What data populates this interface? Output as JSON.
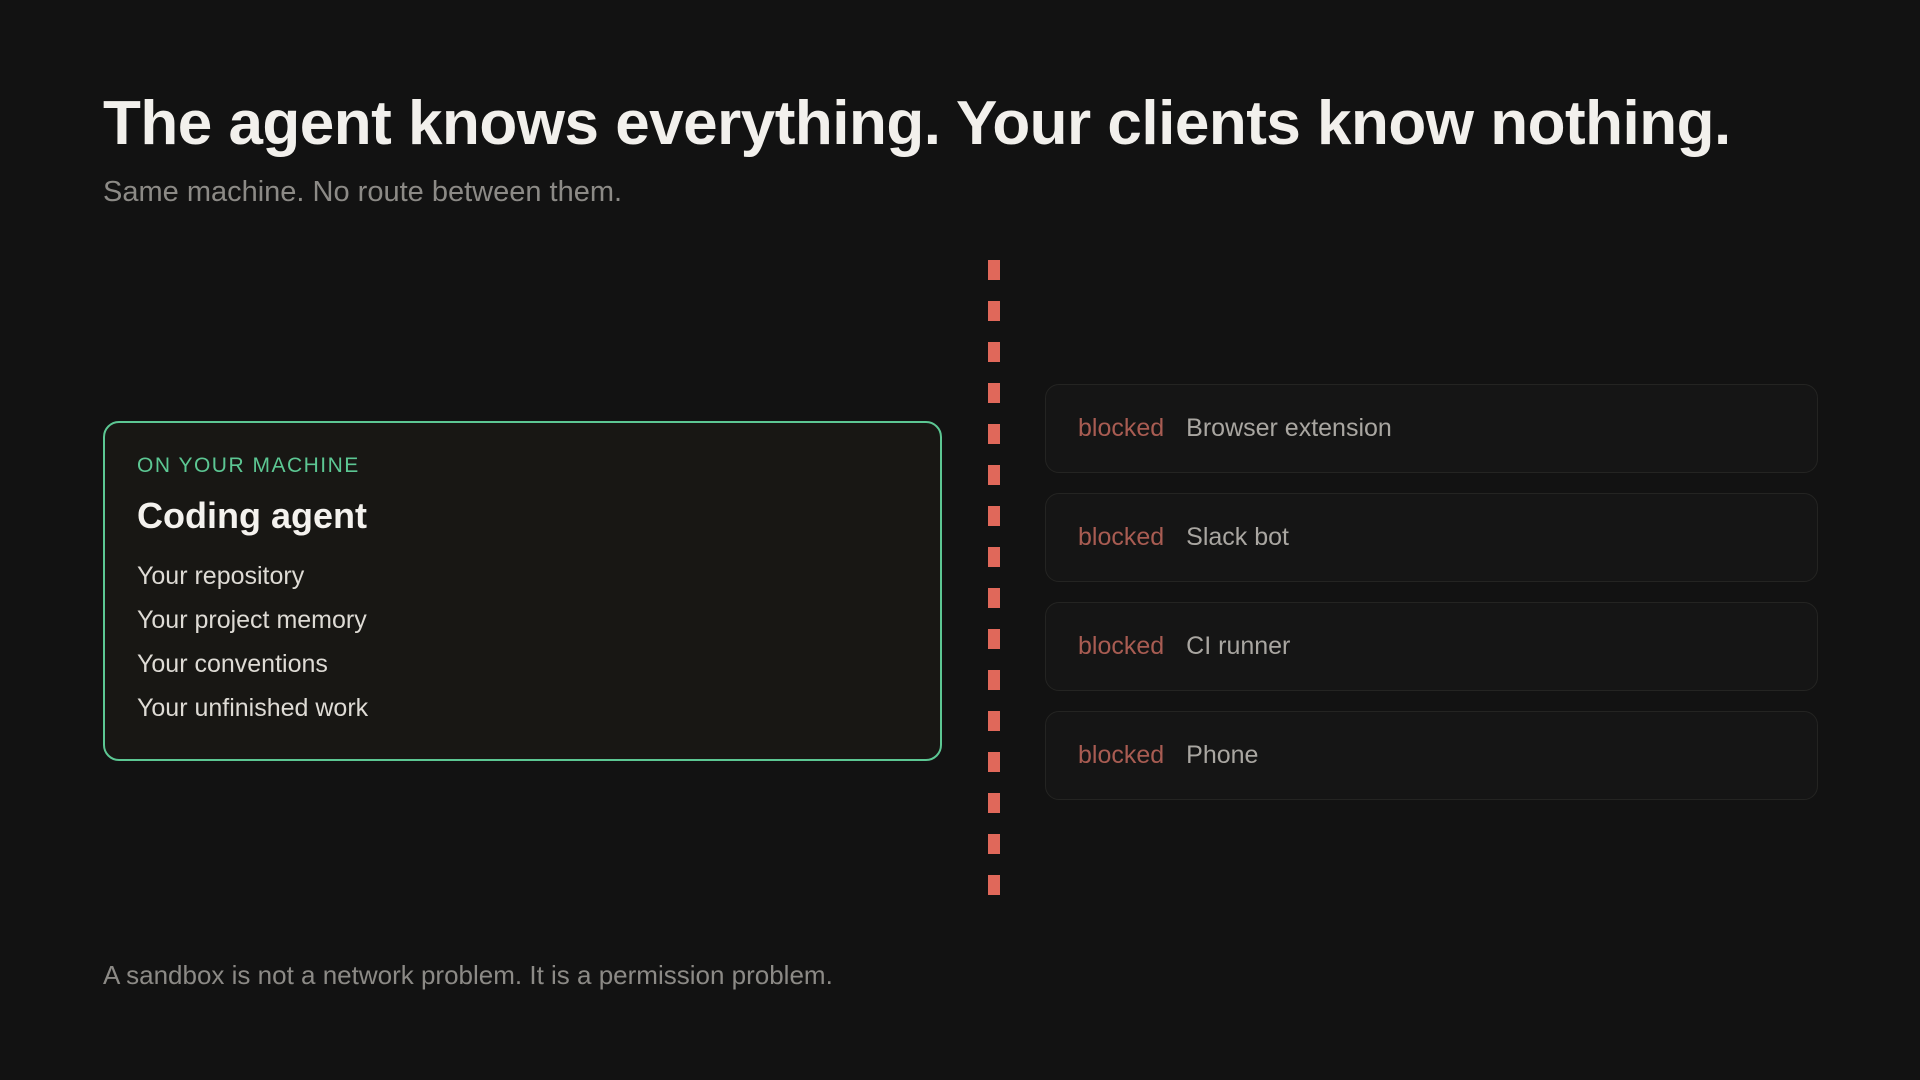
{
  "header": {
    "title": "The agent knows everything. Your clients know nothing.",
    "subtitle": "Same machine. No route between them."
  },
  "agent_card": {
    "eyebrow": "ON YOUR MACHINE",
    "title": "Coding agent",
    "items": [
      "Your repository",
      "Your project memory",
      "Your conventions",
      "Your unfinished work"
    ]
  },
  "clients": [
    {
      "status": "blocked",
      "name": "Browser extension"
    },
    {
      "status": "blocked",
      "name": "Slack bot"
    },
    {
      "status": "blocked",
      "name": "CI runner"
    },
    {
      "status": "blocked",
      "name": "Phone"
    }
  ],
  "footnote": "A sandbox is not a network problem. It is a permission problem.",
  "colors": {
    "background": "#121212",
    "accent_green": "#5cc793",
    "divider_red": "#e0685a",
    "blocked_red": "#a85c52"
  }
}
